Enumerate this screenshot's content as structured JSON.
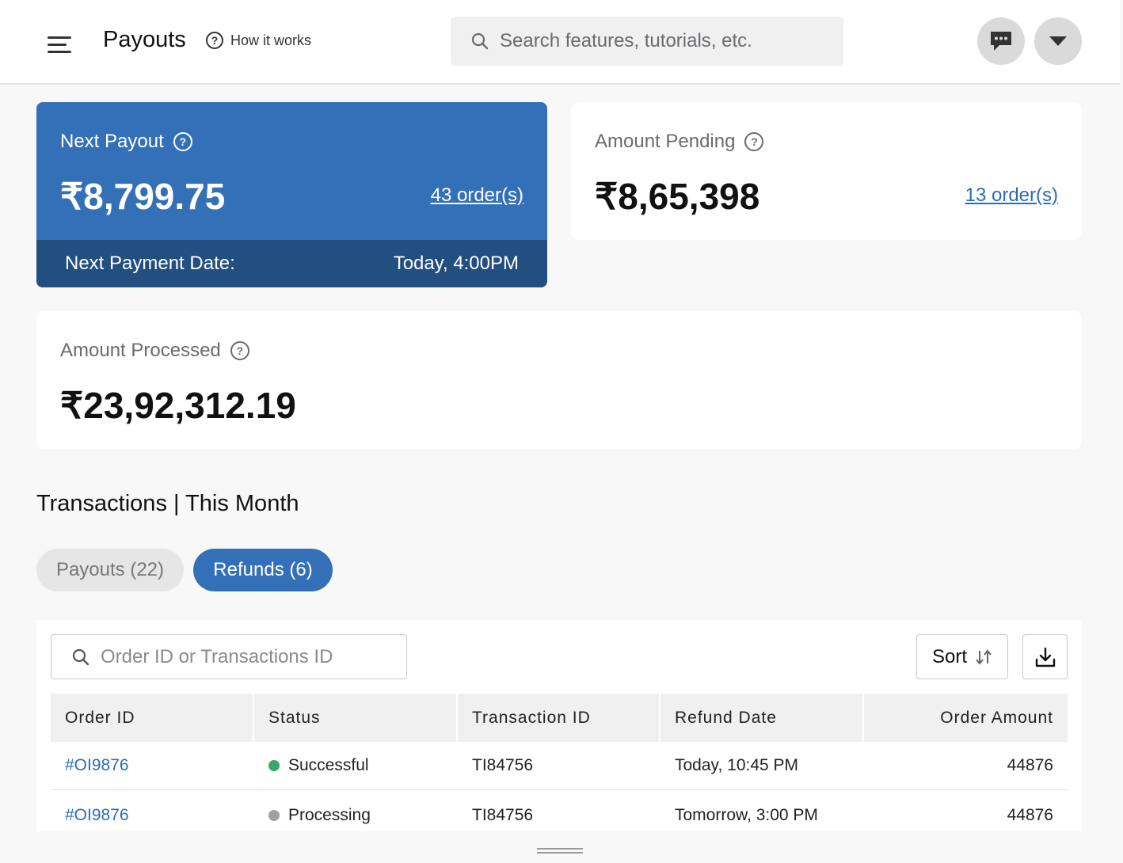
{
  "header": {
    "title": "Payouts",
    "how_it_works": "How it works",
    "search_placeholder": "Search features, tutorials, etc."
  },
  "next_payout": {
    "label": "Next Payout",
    "amount": "₹8,799.75",
    "orders_link": "43 order(s)",
    "payment_date_label": "Next Payment Date:",
    "payment_date_value": "Today, 4:00PM"
  },
  "amount_pending": {
    "label": "Amount Pending",
    "amount": "₹8,65,398",
    "orders_link": "13 order(s)"
  },
  "amount_processed": {
    "label": "Amount Processed",
    "amount": "₹23,92,312.19"
  },
  "transactions": {
    "title": "Transactions | This Month",
    "tabs": [
      {
        "label": "Payouts (22)",
        "active": false
      },
      {
        "label": "Refunds (6)",
        "active": true
      }
    ],
    "filter_placeholder": "Order ID or Transactions ID",
    "sort_label": "Sort",
    "columns": [
      "Order ID",
      "Status",
      "Transaction ID",
      "Refund Date",
      "Order Amount"
    ],
    "rows": [
      {
        "order_id": "#OI9876",
        "status": "Successful",
        "status_color": "#3aa76d",
        "transaction_id": "TI84756",
        "refund_date": "Today, 10:45 PM",
        "amount": "44876"
      },
      {
        "order_id": "#OI9876",
        "status": "Processing",
        "status_color": "#a0a0a3",
        "transaction_id": "TI84756",
        "refund_date": "Tomorrow, 3:00 PM",
        "amount": "44876"
      }
    ]
  },
  "colors": {
    "primary": "#3370b7",
    "primary_dark": "#234f80",
    "link": "#2d6cb5"
  }
}
